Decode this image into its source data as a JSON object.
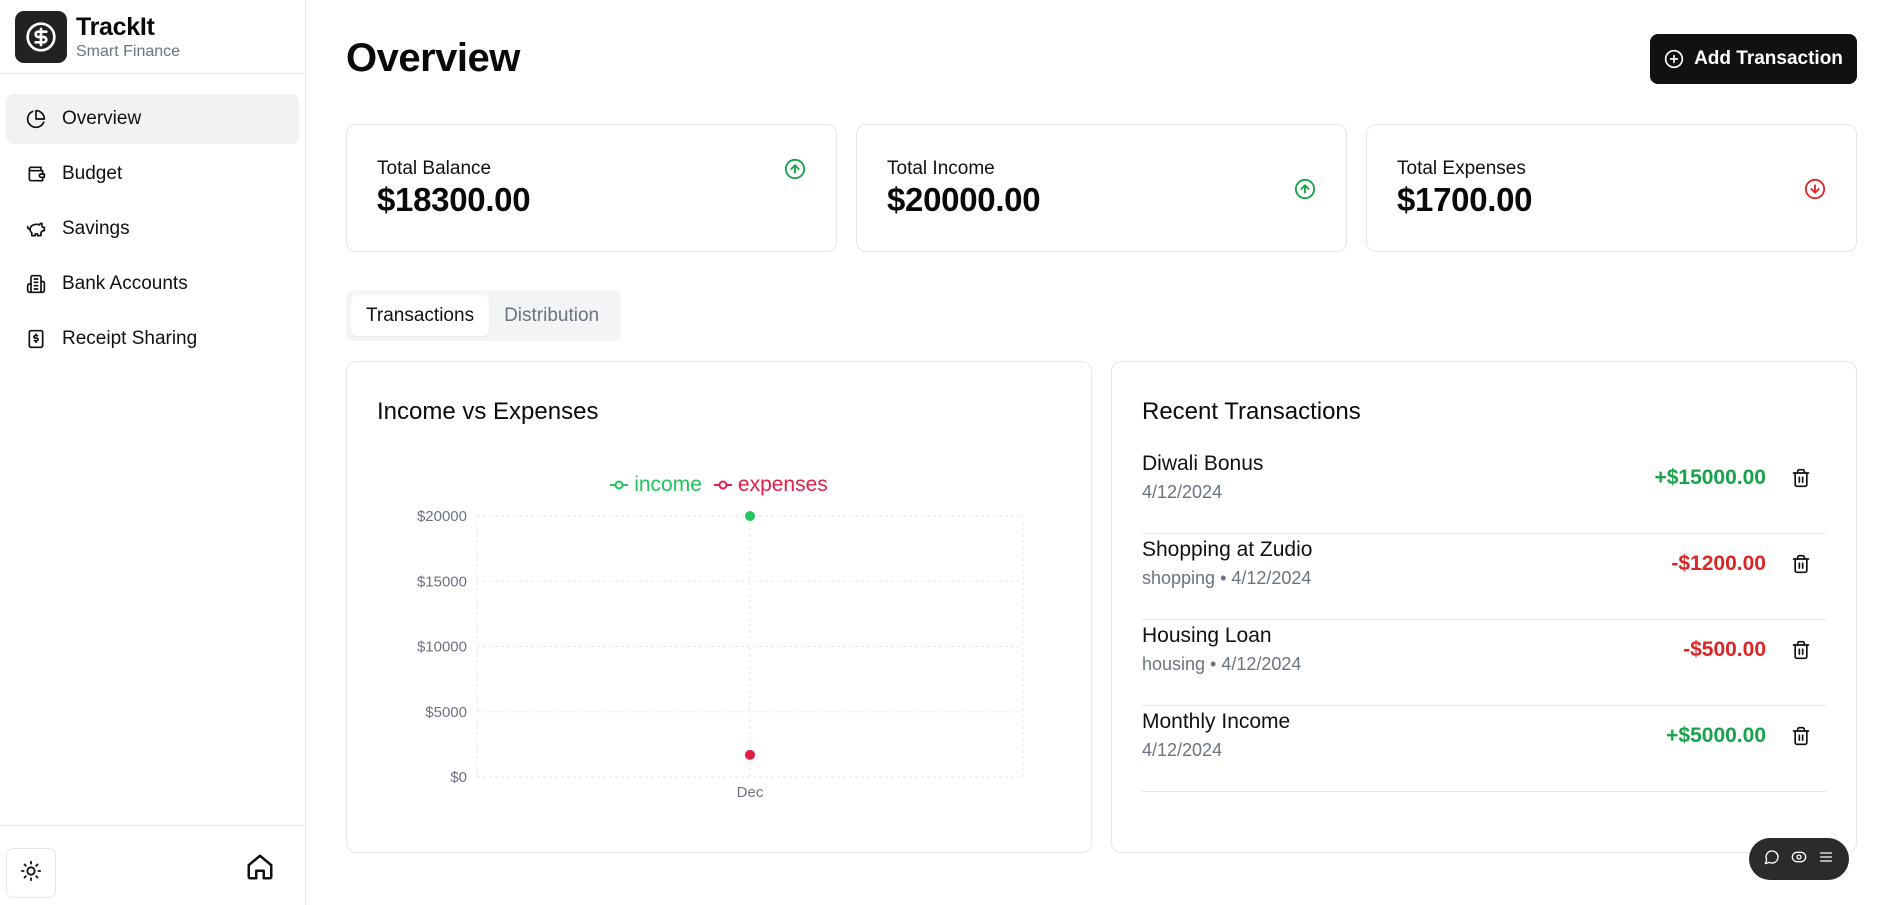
{
  "brand": {
    "title": "TrackIt",
    "subtitle": "Smart Finance"
  },
  "nav": [
    {
      "label": "Overview",
      "icon": "pie-chart-icon",
      "active": true
    },
    {
      "label": "Budget",
      "icon": "wallet-icon"
    },
    {
      "label": "Savings",
      "icon": "piggy-bank-icon"
    },
    {
      "label": "Bank Accounts",
      "icon": "bank-icon"
    },
    {
      "label": "Receipt Sharing",
      "icon": "receipt-icon"
    }
  ],
  "page": {
    "title": "Overview",
    "add_button": "Add Transaction"
  },
  "stats": [
    {
      "label": "Total Balance",
      "value": "$18300.00",
      "trend": "up",
      "color": "#16a34a"
    },
    {
      "label": "Total Income",
      "value": "$20000.00",
      "trend": "up",
      "color": "#16a34a"
    },
    {
      "label": "Total Expenses",
      "value": "$1700.00",
      "trend": "down",
      "color": "#dc2626"
    }
  ],
  "tabs": [
    {
      "label": "Transactions",
      "active": true
    },
    {
      "label": "Distribution",
      "active": false
    }
  ],
  "chart_panel": {
    "title": "Income vs Expenses"
  },
  "chart_data": {
    "type": "line",
    "categories": [
      "Dec"
    ],
    "series": [
      {
        "name": "income",
        "values": [
          20000
        ],
        "color": "#22c55e"
      },
      {
        "name": "expenses",
        "values": [
          1700
        ],
        "color": "#e11d48"
      }
    ],
    "y_ticks": [
      "$0",
      "$5000",
      "$10000",
      "$15000",
      "$20000"
    ],
    "ylim": [
      0,
      20000
    ],
    "grid": true,
    "legend_position": "top-center"
  },
  "tx_panel": {
    "title": "Recent Transactions"
  },
  "transactions": [
    {
      "name": "Diwali Bonus",
      "meta": "4/12/2024",
      "amount": "+$15000.00",
      "type": "income"
    },
    {
      "name": "Shopping at Zudio",
      "meta": "shopping • 4/12/2024",
      "amount": "-$1200.00",
      "type": "expense"
    },
    {
      "name": "Housing Loan",
      "meta": "housing • 4/12/2024",
      "amount": "-$500.00",
      "type": "expense"
    },
    {
      "name": "Monthly Income",
      "meta": "4/12/2024",
      "amount": "+$5000.00",
      "type": "income"
    }
  ],
  "colors": {
    "income": "#16a34a",
    "expense": "#dc2626",
    "primary": "#111111"
  }
}
